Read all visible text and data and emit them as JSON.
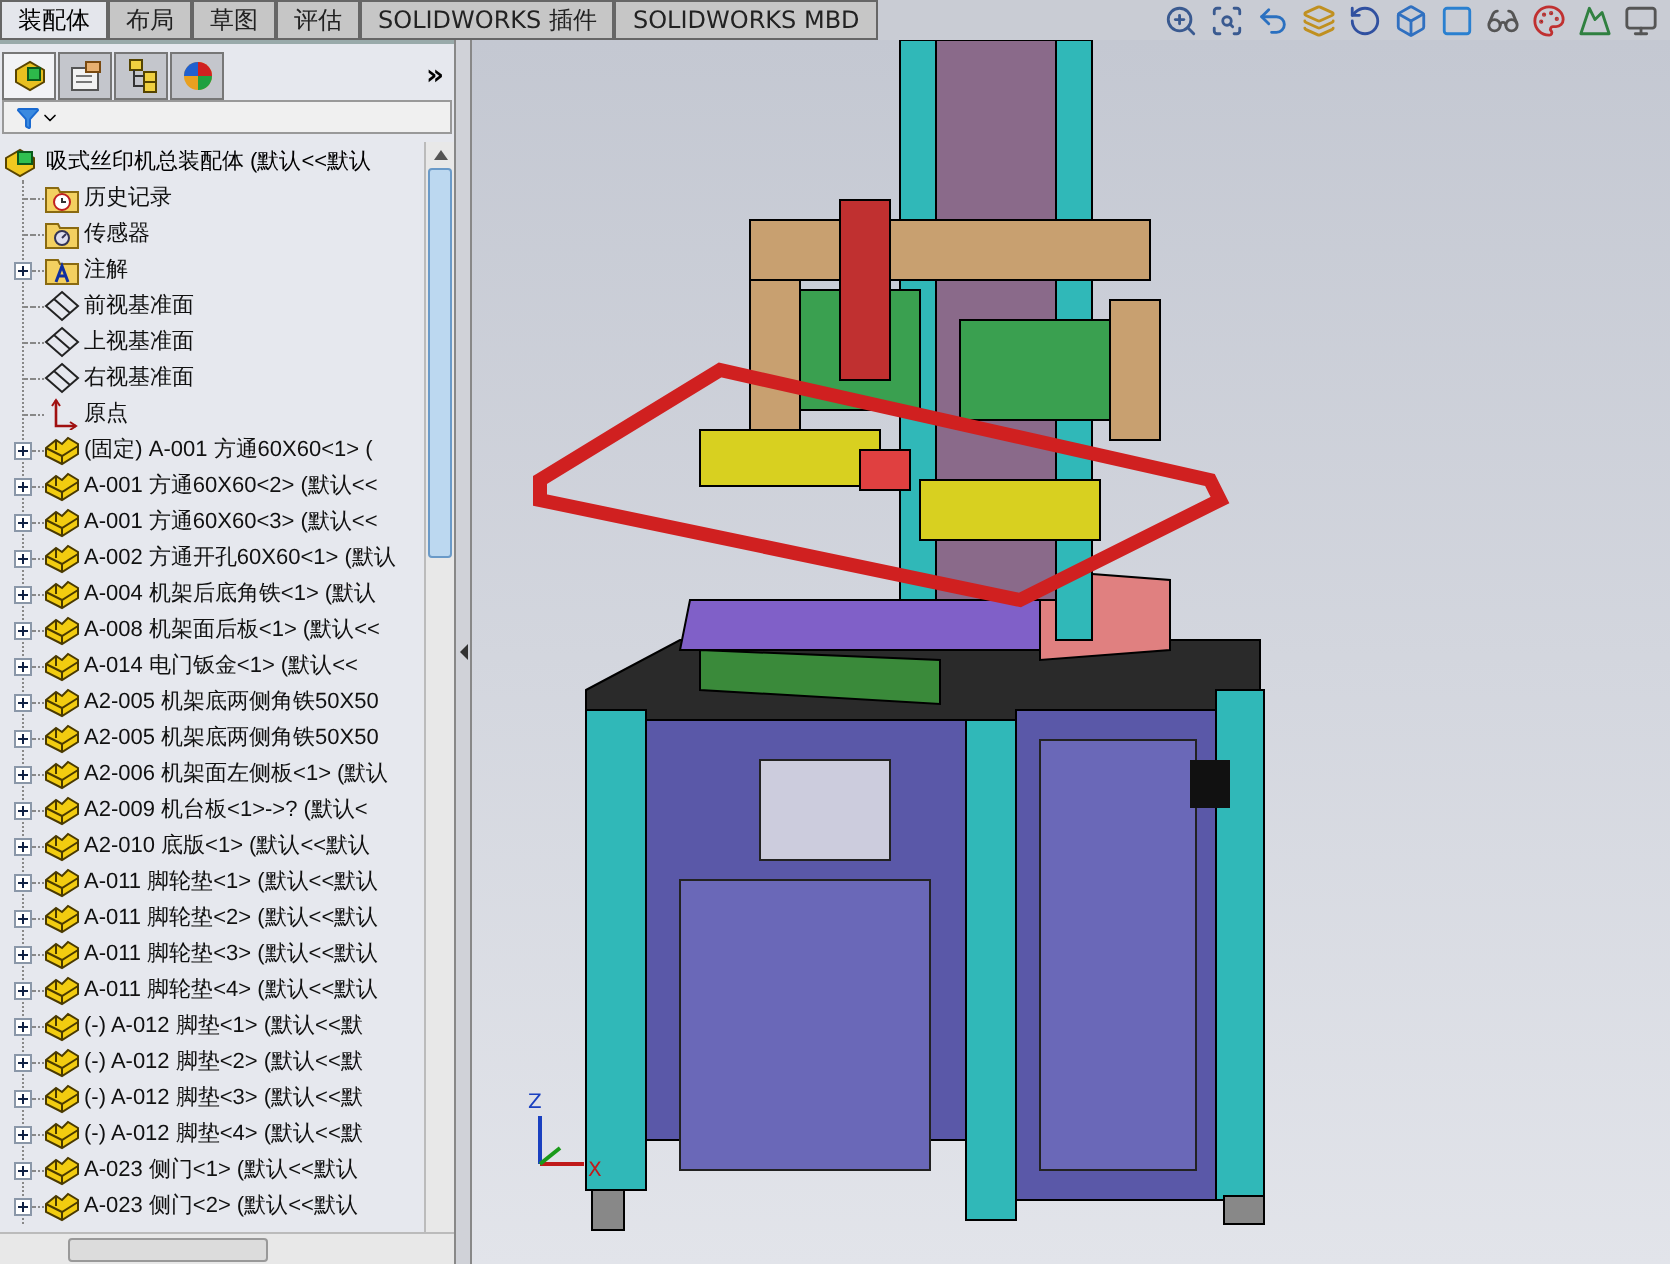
{
  "command_tabs": [
    {
      "label": "装配体",
      "selected": true
    },
    {
      "label": "布局",
      "selected": false
    },
    {
      "label": "草图",
      "selected": false
    },
    {
      "label": "评估",
      "selected": false
    },
    {
      "label": "SOLIDWORKS 插件",
      "selected": false
    },
    {
      "label": "SOLIDWORKS MBD",
      "selected": false
    }
  ],
  "panel_tabs": [
    {
      "kind": "feature-tree",
      "selected": true
    },
    {
      "kind": "property",
      "selected": false
    },
    {
      "kind": "configuration",
      "selected": false
    },
    {
      "kind": "appearance",
      "selected": false
    }
  ],
  "panel_more": "»",
  "tree": {
    "root": {
      "label": "吸式丝印机总装配体 (默认<<默认",
      "kind": "assembly"
    },
    "children": [
      {
        "label": "历史记录",
        "kind": "history",
        "expandable": false
      },
      {
        "label": "传感器",
        "kind": "sensor",
        "expandable": false
      },
      {
        "label": "注解",
        "kind": "annotation",
        "expandable": true
      },
      {
        "label": "前视基准面",
        "kind": "plane",
        "expandable": false
      },
      {
        "label": "上视基准面",
        "kind": "plane",
        "expandable": false
      },
      {
        "label": "右视基准面",
        "kind": "plane",
        "expandable": false
      },
      {
        "label": "原点",
        "kind": "origin",
        "expandable": false
      },
      {
        "label": "(固定) A-001 方通60X60<1> (",
        "kind": "part",
        "expandable": true
      },
      {
        "label": "A-001 方通60X60<2> (默认<<",
        "kind": "part",
        "expandable": true
      },
      {
        "label": "A-001 方通60X60<3> (默认<<",
        "kind": "part",
        "expandable": true
      },
      {
        "label": "A-002 方通开孔60X60<1> (默认",
        "kind": "part",
        "expandable": true
      },
      {
        "label": "A-004 机架后底角铁<1> (默认",
        "kind": "part",
        "expandable": true
      },
      {
        "label": "A-008 机架面后板<1> (默认<<",
        "kind": "part",
        "expandable": true
      },
      {
        "label": "A-014 电门钣金<1> (默认<<",
        "kind": "part",
        "expandable": true
      },
      {
        "label": "A2-005 机架底两侧角铁50X50",
        "kind": "part",
        "expandable": true
      },
      {
        "label": "A2-005 机架底两侧角铁50X50",
        "kind": "part",
        "expandable": true
      },
      {
        "label": "A2-006 机架面左侧板<1> (默认",
        "kind": "part",
        "expandable": true
      },
      {
        "label": "A2-009 机台板<1>->? (默认<",
        "kind": "part",
        "expandable": true
      },
      {
        "label": "A2-010 底版<1> (默认<<默认",
        "kind": "part",
        "expandable": true
      },
      {
        "label": "A-011 脚轮垫<1> (默认<<默认",
        "kind": "part",
        "expandable": true
      },
      {
        "label": "A-011 脚轮垫<2> (默认<<默认",
        "kind": "part",
        "expandable": true
      },
      {
        "label": "A-011 脚轮垫<3> (默认<<默认",
        "kind": "part",
        "expandable": true
      },
      {
        "label": "A-011 脚轮垫<4> (默认<<默认",
        "kind": "part",
        "expandable": true
      },
      {
        "label": "(-) A-012 脚垫<1> (默认<<默",
        "kind": "part",
        "expandable": true
      },
      {
        "label": "(-) A-012 脚垫<2> (默认<<默",
        "kind": "part",
        "expandable": true
      },
      {
        "label": "(-) A-012 脚垫<3> (默认<<默",
        "kind": "part",
        "expandable": true
      },
      {
        "label": "(-) A-012 脚垫<4> (默认<<默",
        "kind": "part",
        "expandable": true
      },
      {
        "label": "A-023 侧门<1> (默认<<默认",
        "kind": "part",
        "expandable": true
      },
      {
        "label": "A-023 侧门<2> (默认<<默认",
        "kind": "part",
        "expandable": true
      }
    ]
  },
  "triad": {
    "z_label": "Z",
    "x_label": "X"
  }
}
